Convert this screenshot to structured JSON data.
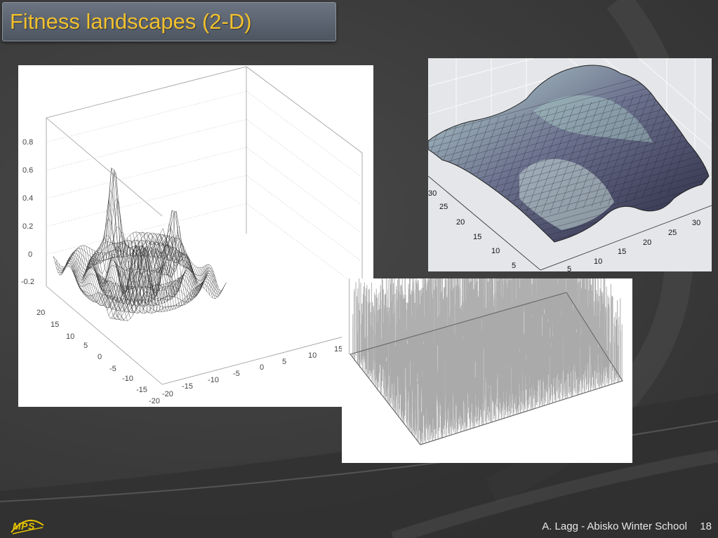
{
  "slide": {
    "title": "Fitness landscapes (2-D)",
    "footer": "A. Lagg - Abisko Winter School",
    "page_number": "18",
    "logo_text": "MPS"
  },
  "left_plot": {
    "z_ticks": [
      "0.8",
      "0.6",
      "0.4",
      "0.2",
      "0",
      "-0.2"
    ],
    "y_ticks": [
      "20",
      "15",
      "10",
      "5",
      "0",
      "-5",
      "-10",
      "-15",
      "-20"
    ],
    "x_ticks": [
      "-20",
      "-15",
      "-10",
      "-5",
      "0",
      "5",
      "10",
      "15"
    ]
  },
  "right_plot": {
    "left_ticks": [
      "30",
      "25",
      "20",
      "15",
      "10",
      "5"
    ],
    "right_ticks": [
      "5",
      "10",
      "15",
      "20",
      "25",
      "30"
    ]
  }
}
